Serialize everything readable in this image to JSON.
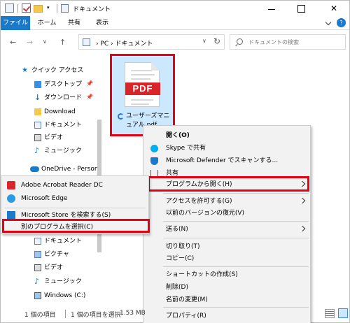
{
  "titlebar": {
    "title": "ドキュメント",
    "close_glyph": "✕"
  },
  "ribbon": {
    "tabs": [
      "ファイル",
      "ホーム",
      "共有",
      "表示"
    ],
    "help_glyph": "?"
  },
  "nav": {
    "back_glyph": "←",
    "forward_glyph": "→",
    "recent_glyph": "∨",
    "up_glyph": "↑"
  },
  "address": {
    "path": "›  PC  ›  ドキュメント",
    "dropdown_glyph": "∨",
    "refresh_glyph": "↻"
  },
  "search": {
    "placeholder": "ドキュメントの検索"
  },
  "navpane": {
    "quick_access": "クイック アクセス",
    "quick_items": [
      "デスクトップ",
      "ダウンロード",
      "Download",
      "ドキュメント",
      "ビデオ",
      "ミュージック"
    ],
    "onedrive": "OneDrive - Person",
    "pc_items": [
      "ドキュメント",
      "ピクチャ",
      "ビデオ",
      "ミュージック",
      "Windows (C:)"
    ]
  },
  "file": {
    "badge": "PDF",
    "name": "ユーザーズマニュアル.pdf"
  },
  "context_menu": {
    "items": [
      "開く(O)",
      "Skype で共有",
      "Microsoft Defender でスキャンする...",
      "共有",
      "プログラムから開く(H)",
      "アクセスを許可する(G)",
      "以前のバージョンの復元(V)",
      "送る(N)",
      "切り取り(T)",
      "コピー(C)",
      "ショートカットの作成(S)",
      "削除(D)",
      "名前の変更(M)",
      "プロパティ(R)"
    ]
  },
  "submenu": {
    "items": [
      "Adobe Acrobat Reader DC",
      "Microsoft Edge",
      "Microsoft Store を検索する(S)",
      "別のプログラムを選択(C)"
    ]
  },
  "status": {
    "count": "1 個の項目",
    "selected": "1 個の項目を選択",
    "size": "1.53 MB"
  },
  "colors": {
    "highlight": "#e60012",
    "accent": "#1979ca",
    "selection": "#cce8ff"
  }
}
